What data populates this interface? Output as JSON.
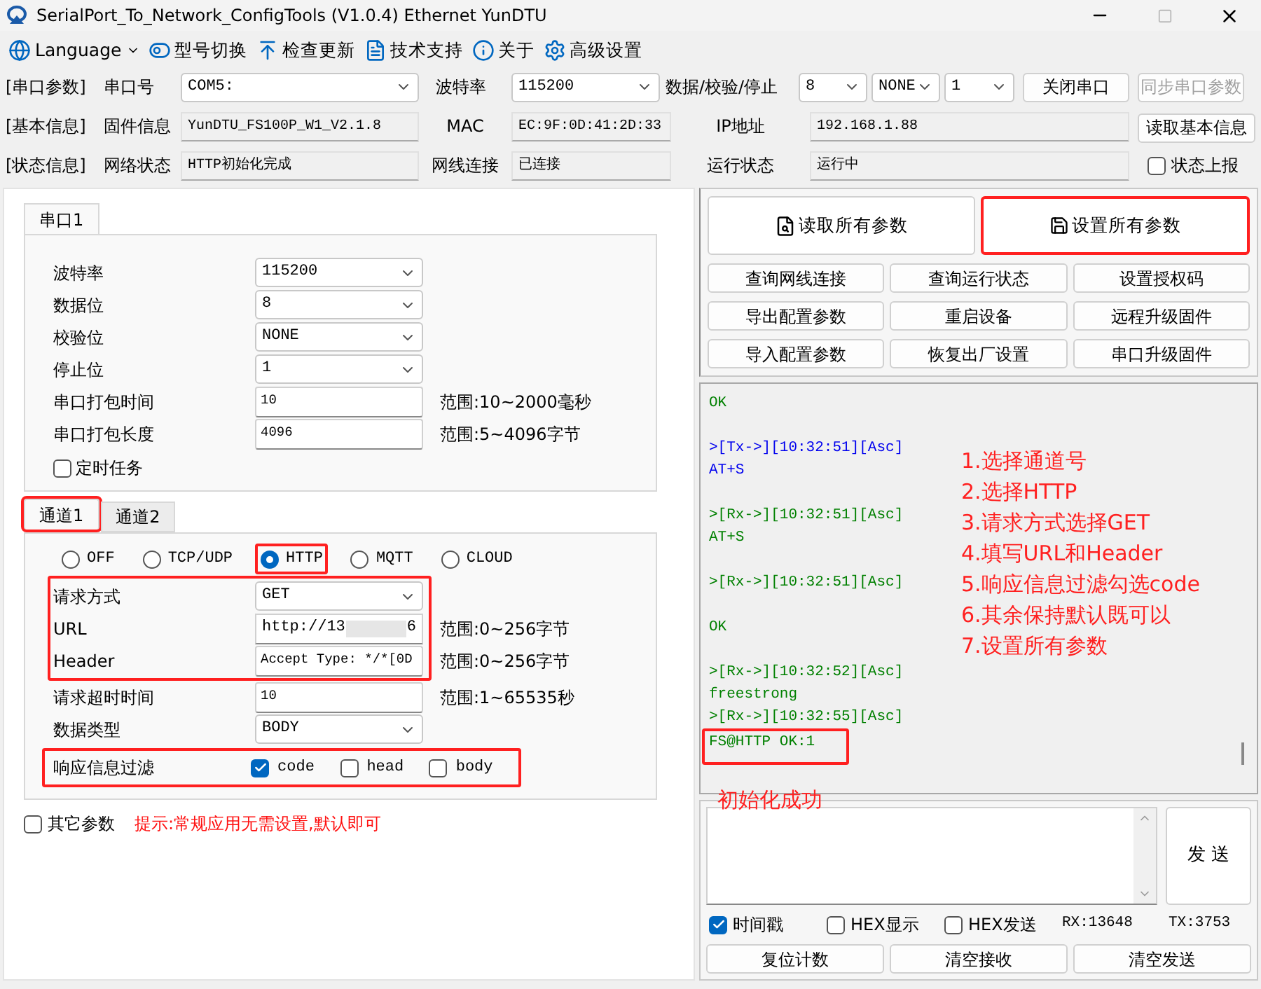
{
  "window": {
    "title": "SerialPort_To_Network_ConfigTools (V1.0.4) Ethernet YunDTU"
  },
  "toolbar": [
    {
      "kind": "language",
      "label": "Language"
    },
    {
      "kind": "model",
      "label": "型号切换"
    },
    {
      "kind": "update",
      "label": "检查更新"
    },
    {
      "kind": "support",
      "label": "技术支持"
    },
    {
      "kind": "about",
      "label": "关于"
    },
    {
      "kind": "advanced",
      "label": "高级设置"
    }
  ],
  "serial_params": {
    "section": "[串口参数]",
    "port_label": "串口号",
    "port": "COM5:",
    "baud_label": "波特率",
    "baud": "115200",
    "format_label": "数据/校验/停止",
    "data": "8",
    "parity": "NONE",
    "stop": "1",
    "buttons": [
      {
        "label": "关闭串口",
        "disabled": false
      },
      {
        "label": "同步串口参数",
        "disabled": true
      }
    ]
  },
  "basic_info": {
    "section": "[基本信息]",
    "fields": [
      {
        "label": "固件信息",
        "value": "YunDTU_FS100P_W1_V2.1.8"
      },
      {
        "label": "MAC",
        "value": "EC:9F:0D:41:2D:33"
      },
      {
        "label": "IP地址",
        "value": "192.168.1.88"
      }
    ],
    "button": "读取基本信息"
  },
  "status_info": {
    "section": "[状态信息]",
    "fields": [
      {
        "label": "网络状态",
        "value": "HTTP初始化完成"
      },
      {
        "label": "网线连接",
        "value": "已连接"
      },
      {
        "label": "运行状态",
        "value": "运行中"
      }
    ],
    "checkbox": {
      "label": "状态上报",
      "checked": false
    }
  },
  "serial_tabs": [
    {
      "label": "串口1",
      "selected": true
    }
  ],
  "serial_rows": [
    {
      "kind": "select",
      "label": "波特率",
      "value": "115200"
    },
    {
      "kind": "select",
      "label": "数据位",
      "value": "8"
    },
    {
      "kind": "select",
      "label": "校验位",
      "value": "NONE"
    },
    {
      "kind": "select",
      "label": "停止位",
      "value": "1"
    },
    {
      "kind": "input",
      "label": "串口打包时间",
      "value": "10",
      "range": "范围:10~2000毫秒"
    },
    {
      "kind": "input",
      "label": "串口打包长度",
      "value": "4096",
      "range": "范围:5~4096字节"
    }
  ],
  "timer": {
    "label": "定时任务",
    "checked": false
  },
  "channel_tabs": [
    {
      "label": "通道1",
      "selected": true,
      "highlighted": true
    },
    {
      "label": "通道2",
      "selected": false,
      "highlighted": false
    }
  ],
  "protocols": [
    {
      "label": "OFF",
      "selected": false,
      "highlighted": false
    },
    {
      "label": "TCP/UDP",
      "selected": false,
      "highlighted": false
    },
    {
      "label": "HTTP",
      "selected": true,
      "highlighted": true
    },
    {
      "label": "MQTT",
      "selected": false,
      "highlighted": false
    },
    {
      "label": "CLOUD",
      "selected": false,
      "highlighted": false
    }
  ],
  "http_group": {
    "highlighted": true,
    "rows": [
      {
        "kind": "select",
        "label": "请求方式",
        "value": "GET"
      },
      {
        "kind": "masked",
        "label": "URL",
        "value": "http://13",
        "value_end": "6",
        "range": "范围:0~256字节"
      },
      {
        "kind": "input",
        "label": "Header",
        "value": "Accept Type: */*[0D",
        "range": "范围:0~256字节"
      }
    ]
  },
  "other_rows": [
    {
      "kind": "input",
      "label": "请求超时时间",
      "value": "10",
      "range": "范围:1~65535秒"
    },
    {
      "kind": "select",
      "label": "数据类型",
      "value": "BODY"
    }
  ],
  "response_filter": {
    "label": "响应信息过滤",
    "highlighted": true,
    "options": [
      {
        "label": "code",
        "checked": true
      },
      {
        "label": "head",
        "checked": false
      },
      {
        "label": "body",
        "checked": false
      }
    ]
  },
  "other_params": {
    "label": "其它参数",
    "checked": false,
    "hint": "提示:常规应用无需设置,默认即可"
  },
  "main_actions": [
    {
      "kind": "read",
      "label": "读取所有参数",
      "highlighted": false
    },
    {
      "kind": "write",
      "label": "设置所有参数",
      "highlighted": true
    }
  ],
  "actions": [
    "查询网线连接",
    "查询运行状态",
    "设置授权码",
    "导出配置参数",
    "重启设备",
    "远程升级固件",
    "导入配置参数",
    "恢复出厂设置",
    "串口升级固件"
  ],
  "log": [
    {
      "kind": "rx",
      "text": "OK",
      "gap_before": false,
      "highlighted": false
    },
    {
      "kind": "tx",
      "text": ">[Tx->][10:32:51][Asc]",
      "gap_before": true,
      "highlighted": false
    },
    {
      "kind": "tx",
      "text": "AT+S",
      "gap_before": false,
      "highlighted": false
    },
    {
      "kind": "rx",
      "text": ">[Rx->][10:32:51][Asc]",
      "gap_before": true,
      "highlighted": false
    },
    {
      "kind": "rx",
      "text": "AT+S",
      "gap_before": false,
      "highlighted": false
    },
    {
      "kind": "rx",
      "text": ">[Rx->][10:32:51][Asc]",
      "gap_before": true,
      "highlighted": false
    },
    {
      "kind": "rx",
      "text": "OK",
      "gap_before": true,
      "highlighted": false
    },
    {
      "kind": "rx",
      "text": ">[Rx->][10:32:52][Asc]",
      "gap_before": true,
      "highlighted": false
    },
    {
      "kind": "rx",
      "text": "freestrong",
      "gap_before": false,
      "highlighted": false
    },
    {
      "kind": "rx",
      "text": ">[Rx->][10:32:55][Asc]",
      "gap_before": false,
      "highlighted": false
    },
    {
      "kind": "rx",
      "text": "FS@HTTP OK:1",
      "gap_before": false,
      "highlighted": true
    }
  ],
  "steps": [
    "1.选择通道号",
    "2.选择HTTP",
    "3.请求方式选择GET",
    "4.填写URL和Header",
    "5.响应信息过滤勾选code",
    "6.其余保持默认既可以",
    "7.设置所有参数"
  ],
  "note": "初始化成功",
  "send_button": "发 送",
  "options": [
    {
      "label": "时间戳",
      "checked": true
    },
    {
      "label": "HEX显示",
      "checked": false
    },
    {
      "label": "HEX发送",
      "checked": false
    }
  ],
  "counters": {
    "rx": "RX:13648",
    "tx": "TX:3753"
  },
  "bottom_buttons": [
    "复位计数",
    "清空接收",
    "清空发送"
  ]
}
